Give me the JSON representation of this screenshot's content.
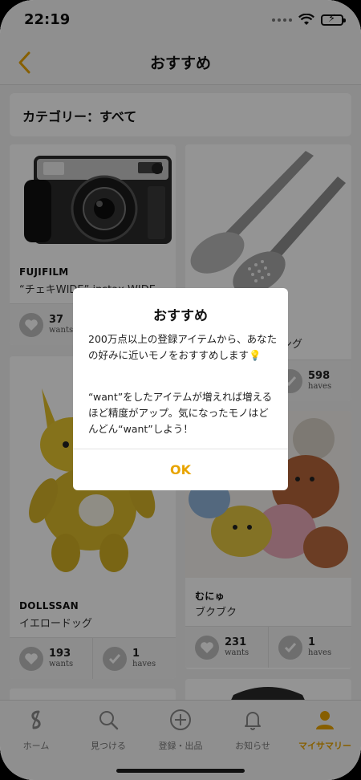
{
  "status_bar": {
    "time": "22:19"
  },
  "nav": {
    "title": "おすすめ",
    "back_icon": "chevron-left-icon"
  },
  "category": {
    "label": "カテゴリー：すべて"
  },
  "items": [
    {
      "brand": "FUJIFILM",
      "name": "“チェキWIDE” instax WIDE",
      "wants_count": "37",
      "wants_label": "wants",
      "haves_count": "",
      "haves_label": "haves"
    },
    {
      "brand": "",
      "name": "ング",
      "wants_count": "",
      "wants_label": "wants",
      "haves_count": "598",
      "haves_label": "haves"
    },
    {
      "brand": "DOLLSSAN",
      "name": "イエロードッグ",
      "wants_count": "193",
      "wants_label": "wants",
      "haves_count": "1",
      "haves_label": "haves"
    },
    {
      "brand": "むにゅ",
      "name": "ブクブク",
      "wants_count": "231",
      "wants_label": "wants",
      "haves_count": "1",
      "haves_label": "haves"
    }
  ],
  "tabbar": {
    "tabs": [
      {
        "label": "ホーム",
        "icon": "home-s-icon",
        "active": false
      },
      {
        "label": "見つける",
        "icon": "search-icon",
        "active": false
      },
      {
        "label": "登録・出品",
        "icon": "plus-circle-icon",
        "active": false
      },
      {
        "label": "お知らせ",
        "icon": "bell-icon",
        "active": false
      },
      {
        "label": "マイサマリー",
        "icon": "person-icon",
        "active": true
      }
    ]
  },
  "dialog": {
    "title": "おすすめ",
    "paragraph1": "200万点以上の登録アイテムから、あなたの好みに近いモノをおすすめします💡",
    "paragraph2": "“want”をしたアイテムが増えれば増えるほど精度がアップ。気になったモノはどんどん“want”しよう！",
    "ok_label": "OK"
  },
  "colors": {
    "accent": "#e8a400",
    "overlay": "rgba(0,0,0,0.42)"
  }
}
